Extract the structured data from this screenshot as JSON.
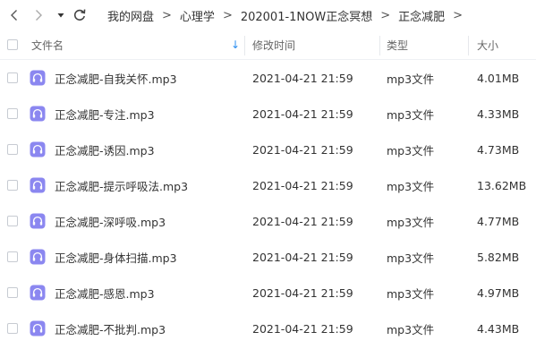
{
  "breadcrumb": [
    "我的网盘",
    "心理学",
    "202001-1NOW正念冥想",
    "正念减肥"
  ],
  "breadcrumb_separator": ">",
  "columns": {
    "name": "文件名",
    "modified": "修改时间",
    "type": "类型",
    "size": "大小"
  },
  "sort_arrow": "↓",
  "files": [
    {
      "name": "正念减肥-自我关怀.mp3",
      "modified": "2021-04-21 21:59",
      "type": "mp3文件",
      "size": "4.01MB"
    },
    {
      "name": "正念减肥-专注.mp3",
      "modified": "2021-04-21 21:59",
      "type": "mp3文件",
      "size": "4.33MB"
    },
    {
      "name": "正念减肥-诱因.mp3",
      "modified": "2021-04-21 21:59",
      "type": "mp3文件",
      "size": "4.73MB"
    },
    {
      "name": "正念减肥-提示呼吸法.mp3",
      "modified": "2021-04-21 21:59",
      "type": "mp3文件",
      "size": "13.62MB"
    },
    {
      "name": "正念减肥-深呼吸.mp3",
      "modified": "2021-04-21 21:59",
      "type": "mp3文件",
      "size": "4.77MB"
    },
    {
      "name": "正念减肥-身体扫描.mp3",
      "modified": "2021-04-21 21:59",
      "type": "mp3文件",
      "size": "5.82MB"
    },
    {
      "name": "正念减肥-感恩.mp3",
      "modified": "2021-04-21 21:59",
      "type": "mp3文件",
      "size": "4.97MB"
    },
    {
      "name": "正念减肥-不批判.mp3",
      "modified": "2021-04-21 21:59",
      "type": "mp3文件",
      "size": "4.43MB"
    }
  ],
  "colors": {
    "accent": "#2b8ef0",
    "file_icon": "#8b87f0",
    "separator": "#e6e8ec"
  },
  "icons": {
    "back": "chevron-left-icon",
    "forward": "chevron-right-icon",
    "history": "caret-down-icon",
    "refresh": "refresh-icon",
    "file": "audio-file-icon"
  }
}
